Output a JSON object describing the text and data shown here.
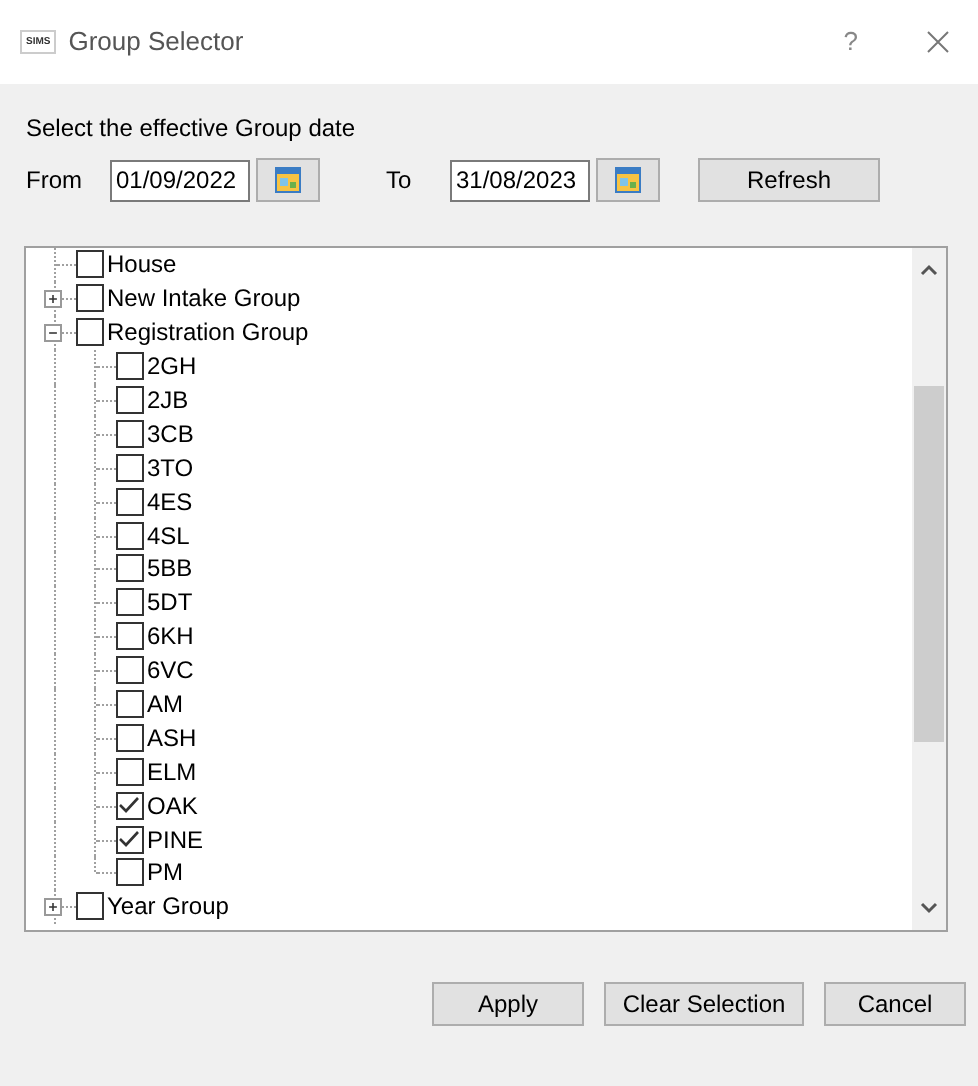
{
  "window": {
    "app_icon_text": "SIMS",
    "title": "Group Selector",
    "help": "?"
  },
  "date_prompt": "Select the effective Group date",
  "from": {
    "label": "From",
    "value": "01/09/2022"
  },
  "to": {
    "label": "To",
    "value": "31/08/2023"
  },
  "refresh_button": "Refresh",
  "tree": [
    {
      "label": "House",
      "checked": false
    },
    {
      "label": "New Intake Group",
      "checked": false,
      "expanded": false
    },
    {
      "label": "Registration Group",
      "checked": false,
      "expanded": true,
      "children": [
        {
          "label": "2GH",
          "checked": false
        },
        {
          "label": "2JB",
          "checked": false
        },
        {
          "label": "3CB",
          "checked": false
        },
        {
          "label": "3TO",
          "checked": false
        },
        {
          "label": "4ES",
          "checked": false
        },
        {
          "label": "4SL",
          "checked": false
        },
        {
          "label": "5BB",
          "checked": false
        },
        {
          "label": "5DT",
          "checked": false
        },
        {
          "label": "6KH",
          "checked": false
        },
        {
          "label": "6VC",
          "checked": false
        },
        {
          "label": "AM",
          "checked": false
        },
        {
          "label": "ASH",
          "checked": false
        },
        {
          "label": "ELM",
          "checked": false
        },
        {
          "label": "OAK",
          "checked": true
        },
        {
          "label": "PINE",
          "checked": true
        },
        {
          "label": "PM",
          "checked": false
        }
      ]
    },
    {
      "label": "Year Group",
      "checked": false,
      "expanded": false
    }
  ],
  "buttons": [
    "Apply",
    "Clear Selection",
    "Cancel"
  ]
}
